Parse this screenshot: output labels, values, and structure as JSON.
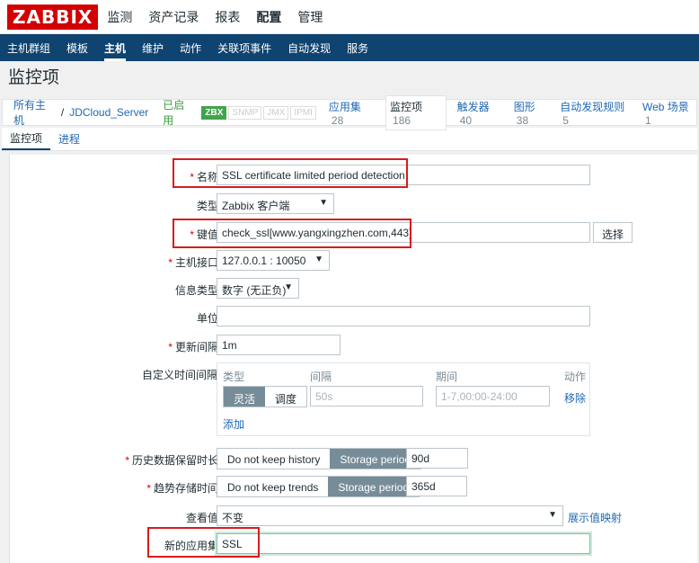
{
  "app": {
    "logo": "ZABBIX"
  },
  "topnav": {
    "items": [
      "监测",
      "资产记录",
      "报表",
      "配置",
      "管理"
    ],
    "active": 3
  },
  "subnav": {
    "items": [
      "主机群组",
      "模板",
      "主机",
      "维护",
      "动作",
      "关联项事件",
      "自动发现",
      "服务"
    ],
    "active": 2
  },
  "page_title": "监控项",
  "breadcrumb": {
    "all_hosts": "所有主机",
    "separator": "/",
    "host": "JDCloud_Server",
    "status": "已启用",
    "availability": [
      "ZBX",
      "SNMP",
      "JMX",
      "IPMI"
    ],
    "tabs": [
      {
        "label": "应用集",
        "count": "28"
      },
      {
        "label": "监控项",
        "count": "186"
      },
      {
        "label": "触发器",
        "count": "40"
      },
      {
        "label": "图形",
        "count": "38"
      },
      {
        "label": "自动发现规则",
        "count": "5"
      },
      {
        "label": "Web 场景",
        "count": "1"
      }
    ]
  },
  "form_tabs": [
    "监控项",
    "进程"
  ],
  "form": {
    "name_label": "名称",
    "name_value": "SSL certificate limited period detection",
    "type_label": "类型",
    "type_value": "Zabbix 客户端",
    "key_label": "键值",
    "key_value": "check_ssl[www.yangxingzhen.com,443]",
    "key_button": "选择",
    "interface_label": "主机接口",
    "interface_value": "127.0.0.1 : 10050",
    "info_type_label": "信息类型",
    "info_type_value": "数字 (无正负)",
    "units_label": "单位",
    "units_value": "",
    "interval_label": "更新间隔",
    "interval_value": "1m",
    "custom_label": "自定义时间间隔",
    "custom": {
      "col_type": "类型",
      "col_interval": "间隔",
      "col_period": "期间",
      "col_action": "动作",
      "seg_flexible": "灵活",
      "seg_scheduling": "调度",
      "interval_placeholder": "50s",
      "period_placeholder": "1-7,00:00-24:00",
      "remove": "移除",
      "add": "添加"
    },
    "history_label": "历史数据保留时长",
    "history_no_keep": "Do not keep history",
    "history_storage": "Storage period",
    "history_value": "90d",
    "trends_label": "趋势存储时间",
    "trends_no_keep": "Do not keep trends",
    "trends_storage": "Storage period",
    "trends_value": "365d",
    "valuemap_label": "查看值",
    "valuemap_value": "不变",
    "valuemap_link": "展示值映射",
    "new_app_label": "新的应用集",
    "new_app_value": "SSL"
  }
}
